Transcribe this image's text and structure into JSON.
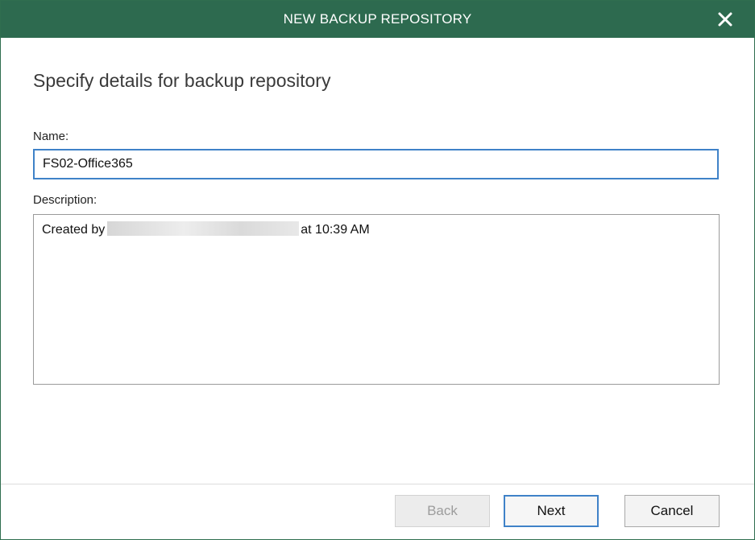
{
  "window": {
    "title": "NEW BACKUP REPOSITORY",
    "close_icon": "close-icon"
  },
  "page": {
    "heading": "Specify details for backup repository"
  },
  "form": {
    "name_label": "Name:",
    "name_value": "FS02-Office365",
    "description_label": "Description:",
    "description_prefix": "Created by",
    "description_suffix": "at 10:39 AM"
  },
  "buttons": {
    "back": "Back",
    "next": "Next",
    "cancel": "Cancel"
  },
  "colors": {
    "titlebar": "#2d6a4f",
    "focus_border": "#3f82c8"
  }
}
